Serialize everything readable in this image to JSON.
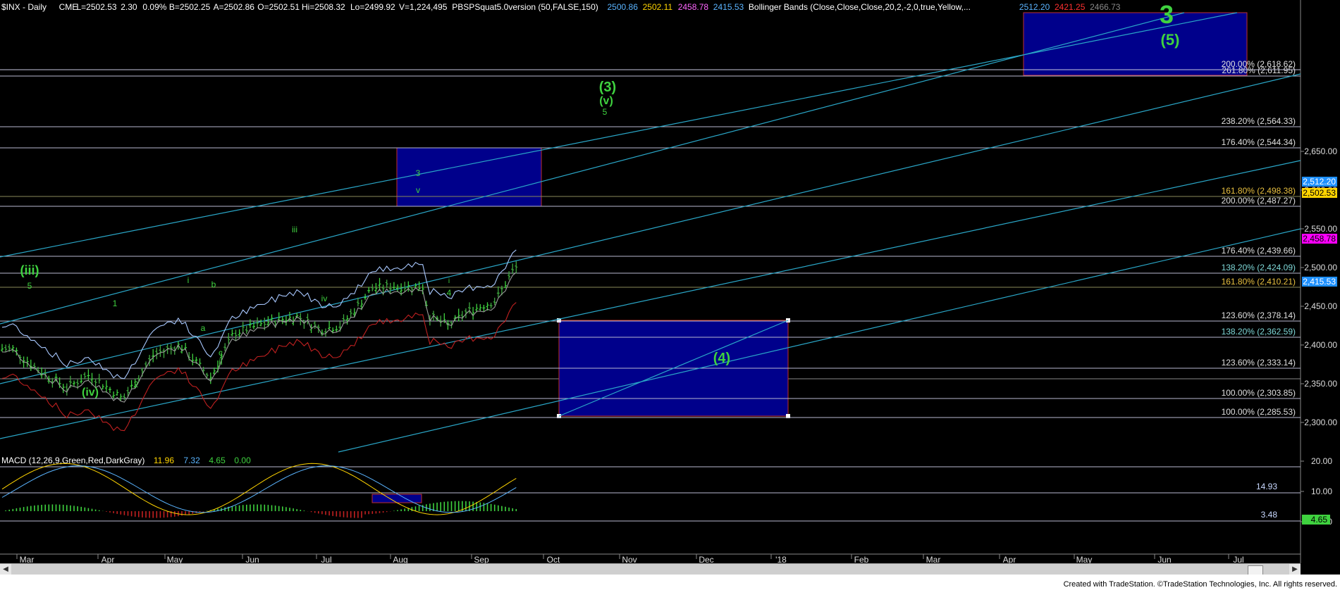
{
  "header": {
    "symbol": "$INX - Daily",
    "exchange": "CME",
    "last": "L=2502.53",
    "change": "2.30",
    "pct": "0.09%",
    "bid": "B=2502.25",
    "ask": "A=2502.86",
    "open": "O=2502.51",
    "high": "Hi=2508.32",
    "low": "Lo=2499.92",
    "volume": "V=1,224,495",
    "study1": "PBSPSquat5.0version (50,FALSE,150)",
    "study1_values": [
      {
        "v": "2500.86",
        "c": "#5ab4ff"
      },
      {
        "v": "2502.11",
        "c": "#ffd400"
      },
      {
        "v": "2458.78",
        "c": "#ff66ff"
      },
      {
        "v": "2415.53",
        "c": "#5ab4ff"
      }
    ],
    "study2": "Bollinger Bands (Close,Close,Close,20,2,-2,0,true,Yellow,...",
    "study2_values": [
      {
        "v": "2512.20",
        "c": "#5ab4ff"
      },
      {
        "v": "2421.25",
        "c": "#ff3030"
      },
      {
        "v": "2466.73",
        "c": "#888888"
      }
    ]
  },
  "macd_header": {
    "label": "MACD (12,26,9,Green,Red,DarkGray)",
    "values": [
      {
        "v": "11.96",
        "c": "#ffd400"
      },
      {
        "v": "7.32",
        "c": "#5ab4ff"
      },
      {
        "v": "4.65",
        "c": "#3fd23f"
      },
      {
        "v": "0.00",
        "c": "#3fd23f"
      }
    ]
  },
  "footer": {
    "credit": "Created with TradeStation. ©TradeStation Technologies, Inc. All rights reserved."
  },
  "colors": {
    "bg": "#000000",
    "axis_text": "#dddddd",
    "fib": "#b0b0c8",
    "channel": "#2aa7c8",
    "box": "#00008b",
    "box_border": "#c03030",
    "wave": "#3fd23f",
    "up_bar": "#3fd23f",
    "down_bar": "#b02020"
  },
  "chart_data": {
    "type": "line",
    "x_months": [
      "Mar",
      "Apr",
      "May",
      "Jun",
      "Jul",
      "Aug",
      "Sep",
      "Oct",
      "Nov",
      "Dec",
      "'18",
      "Feb",
      "Mar",
      "Apr",
      "May",
      "Jun",
      "Jul"
    ],
    "price_axis": {
      "ticks": [
        2300,
        2350,
        2400,
        2450,
        2500,
        2550,
        2600,
        2650
      ],
      "min": 2235,
      "max": 2690
    },
    "macd_axis": {
      "ticks": [
        0.0,
        10.0,
        20.0
      ],
      "labels": [
        "0.00",
        "10.00",
        "20.00"
      ]
    },
    "price_series_approx": [
      {
        "d": "2017-03-01",
        "c": 2395
      },
      {
        "d": "2017-03-10",
        "c": 2370
      },
      {
        "d": "2017-03-22",
        "c": 2345
      },
      {
        "d": "2017-03-31",
        "c": 2362
      },
      {
        "d": "2017-04-13",
        "c": 2330
      },
      {
        "d": "2017-04-25",
        "c": 2388
      },
      {
        "d": "2017-05-05",
        "c": 2400
      },
      {
        "d": "2017-05-17",
        "c": 2358
      },
      {
        "d": "2017-05-26",
        "c": 2415
      },
      {
        "d": "2017-06-09",
        "c": 2430
      },
      {
        "d": "2017-06-20",
        "c": 2437
      },
      {
        "d": "2017-06-29",
        "c": 2420
      },
      {
        "d": "2017-07-07",
        "c": 2425
      },
      {
        "d": "2017-07-19",
        "c": 2473
      },
      {
        "d": "2017-07-27",
        "c": 2476
      },
      {
        "d": "2017-08-08",
        "c": 2475
      },
      {
        "d": "2017-08-10",
        "c": 2438
      },
      {
        "d": "2017-08-18",
        "c": 2425
      },
      {
        "d": "2017-08-25",
        "c": 2443
      },
      {
        "d": "2017-09-05",
        "c": 2457
      },
      {
        "d": "2017-09-12",
        "c": 2496
      },
      {
        "d": "2017-09-14",
        "c": 2502.53
      }
    ],
    "fib_levels": [
      {
        "label": "200.00% (2,618.62)",
        "value": 2618.62
      },
      {
        "label": "261.80% (2,611.95)",
        "value": 2611.95
      },
      {
        "label": "238.20% (2,564.33)",
        "value": 2564.33
      },
      {
        "label": "176.40% (2,544.34)",
        "value": 2544.34
      },
      {
        "label": "161.80% (2,498.38)",
        "value": 2498.38
      },
      {
        "label": "200.00% (2,487.27)",
        "value": 2487.27
      },
      {
        "label": "176.40% (2,439.66)",
        "value": 2439.66
      },
      {
        "label": "138.20% (2,424.09)",
        "value": 2424.09
      },
      {
        "label": "161.80% (2,410.21)",
        "value": 2410.21
      },
      {
        "label": "123.60% (2,378.14)",
        "value": 2378.14
      },
      {
        "label": "138.20% (2,362.59)",
        "value": 2362.59
      },
      {
        "label": "123.60% (2,333.14)",
        "value": 2333.14
      },
      {
        "label": "100.00% (2,303.85)",
        "value": 2303.85
      },
      {
        "label": "100.00% (2,285.53)",
        "value": 2285.53
      }
    ],
    "right_tags": [
      {
        "label": "2,512.20",
        "value": 2512.2,
        "bg": "#1e90ff",
        "fg": "#ffffff"
      },
      {
        "label": "2,502.53",
        "value": 2502.53,
        "bg": "#ffd400",
        "fg": "#000000"
      },
      {
        "label": "2,458.78",
        "value": 2458.78,
        "bg": "#ff00ff",
        "fg": "#000000"
      },
      {
        "label": "2,415.53",
        "value": 2415.53,
        "bg": "#1e90ff",
        "fg": "#ffffff"
      }
    ],
    "wave_labels": [
      {
        "t": "3",
        "s": "big"
      },
      {
        "t": "(5)",
        "s": "big"
      },
      {
        "t": "(3)",
        "s": "mid"
      },
      {
        "t": "(v)",
        "s": "mid"
      },
      {
        "t": "5",
        "s": "small"
      },
      {
        "t": "(iii)",
        "s": "mid"
      },
      {
        "t": "5",
        "s": "small"
      },
      {
        "t": "(iv)",
        "s": "mid"
      },
      {
        "t": "1",
        "s": "small"
      },
      {
        "t": "2",
        "s": "small"
      },
      {
        "t": "i",
        "s": "small"
      },
      {
        "t": "a",
        "s": "small"
      },
      {
        "t": "b",
        "s": "small"
      },
      {
        "t": "c",
        "s": "small"
      },
      {
        "t": "ii",
        "s": "small"
      },
      {
        "t": "iii",
        "s": "small"
      },
      {
        "t": "iv",
        "s": "small"
      },
      {
        "t": "3",
        "s": "small"
      },
      {
        "t": "v",
        "s": "small"
      },
      {
        "t": "4",
        "s": "small"
      },
      {
        "t": "i",
        "s": "small"
      },
      {
        "t": "(4)",
        "s": "mid"
      }
    ],
    "macd_levels": [
      {
        "label": "14.93",
        "value": 14.93
      },
      {
        "label": "3.48",
        "value": 3.48
      }
    ],
    "macd_tag": {
      "label": "4.65",
      "value": 4.65
    },
    "zones": [
      {
        "name": "wave-5-target-zone",
        "from": "2018-04-05",
        "to": "2018-07-04",
        "lo": 2611.95,
        "hi": 2690
      },
      {
        "name": "wave-3-top-zone",
        "from": "2017-07-24",
        "to": "2017-09-21",
        "lo": 2487.27,
        "hi": 2544.34
      },
      {
        "name": "wave-4-support-zone",
        "from": "2017-09-28",
        "to": "2017-12-31",
        "lo": 2285.53,
        "hi": 2378.14
      }
    ],
    "grid": false
  }
}
